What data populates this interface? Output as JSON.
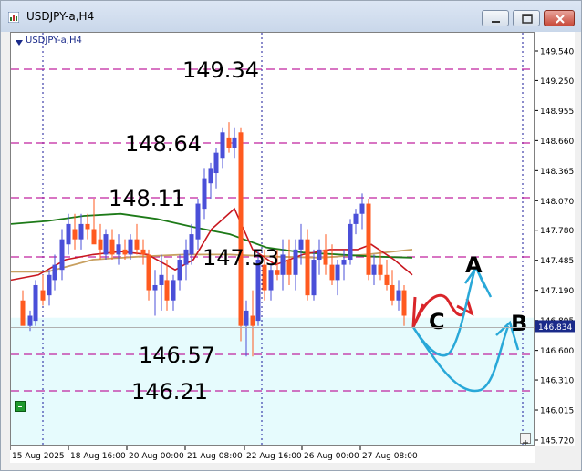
{
  "window": {
    "title": "USDJPY-a,H4"
  },
  "chart": {
    "symbol_label": "USDJPY-a,H4",
    "current_price": "146.834"
  },
  "price_axis": {
    "labels": [
      "149.540",
      "149.250",
      "148.955",
      "148.660",
      "148.365",
      "148.070",
      "147.780",
      "147.485",
      "147.190",
      "146.895",
      "146.600",
      "146.310",
      "146.015",
      "145.720"
    ],
    "min": 145.72,
    "max": 149.54
  },
  "time_axis": {
    "labels": [
      "15 Aug 2025",
      "18 Aug 16:00",
      "20 Aug 00:00",
      "21 Aug 08:00",
      "22 Aug 16:00",
      "26 Aug 00:00",
      "27 Aug 08:00"
    ]
  },
  "levels": [
    {
      "price": 149.34,
      "label": "149.34"
    },
    {
      "price": 148.64,
      "label": "148.64"
    },
    {
      "price": 148.11,
      "label": "148.11"
    },
    {
      "price": 147.53,
      "label": "147.53"
    },
    {
      "price": 146.57,
      "label": "146.57"
    },
    {
      "price": 146.21,
      "label": "146.21"
    }
  ],
  "scenario_labels": {
    "a": "A",
    "b": "B",
    "c": "C"
  },
  "colors": {
    "level_line": "#c0239f",
    "bull": "#4a4fd8",
    "bear": "#ff5a1f",
    "ma_red": "#c8161e",
    "ma_green": "#1d7a18",
    "ma_tan": "#c8a060",
    "zone": "#e6fbfd",
    "arrow_red": "#d9252a",
    "arrow_blue": "#29a8d8"
  },
  "icons": {
    "app": "chart-icon",
    "minimize": "minimize-icon",
    "maximize": "maximize-icon",
    "close": "close-icon",
    "dropdown": "triangle-down-icon",
    "scale_fix": "plus-icon",
    "indicator": "green-square-icon"
  }
}
